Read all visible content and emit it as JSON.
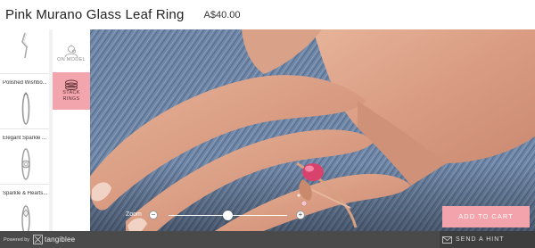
{
  "product": {
    "title": "Pink Murano Glass Leaf Ring",
    "price": "A$40.00"
  },
  "ring_list": {
    "items": [
      {
        "label": ""
      },
      {
        "label": "Polished Wishbo..."
      },
      {
        "label": "Elegant Sparkle ..."
      },
      {
        "label": "Sparkle & Hearts..."
      }
    ]
  },
  "tools": {
    "on_model": "ON MODEL",
    "stack_rings_line1": "STACK",
    "stack_rings_line2": "RINGS"
  },
  "zoom": {
    "label": "Zoom",
    "minus": "−",
    "plus": "+",
    "level": 0.5
  },
  "actions": {
    "add_to_cart": "ADD TO CART",
    "send_hint": "SEND A HINT"
  },
  "footer": {
    "powered_by": "Powered by",
    "brand": "tangiblee"
  },
  "colors": {
    "accent": "#f3a3ab",
    "footer": "#4a4a4a"
  }
}
